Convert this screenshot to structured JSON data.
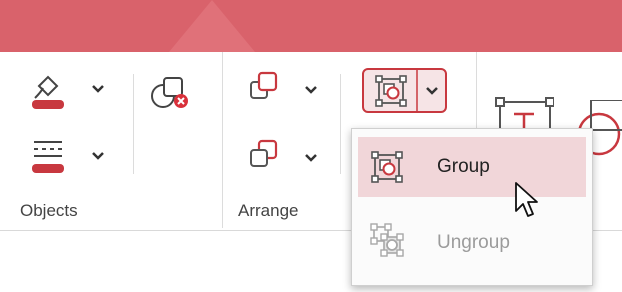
{
  "ribbon": {
    "groups": {
      "objects_label": "Objects",
      "arrange_label": "Arrange"
    }
  },
  "menu": {
    "items": [
      {
        "label": "Group",
        "enabled": true
      },
      {
        "label": "Ungroup",
        "enabled": false
      }
    ]
  },
  "colors": {
    "accent": "#c8383f",
    "header": "#d9626b",
    "hover": "#f1d6d9"
  },
  "icons": {
    "fill": "fill-color-icon",
    "line": "line-style-icon",
    "delete": "delete-shapes-icon",
    "front": "bring-forward-icon",
    "back": "send-backward-icon",
    "group": "group-icon",
    "ungroup": "ungroup-icon",
    "text": "text-box-icon",
    "circle": "ellipse-icon",
    "cursor": "mouse-cursor-icon"
  }
}
